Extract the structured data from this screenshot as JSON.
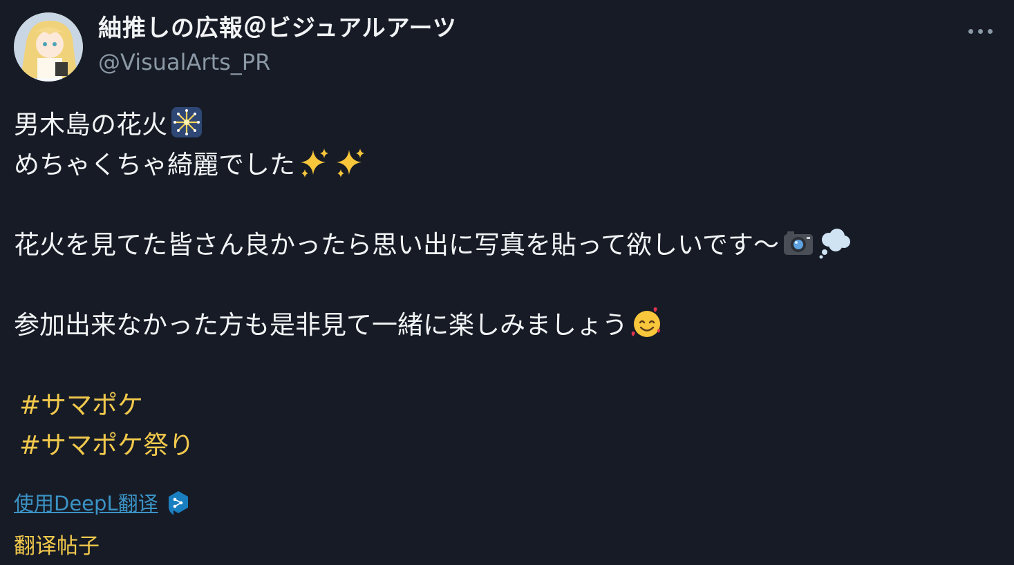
{
  "user": {
    "display_name": "紬推しの広報＠ビジュアルアーツ",
    "handle": "@VisualArts_PR",
    "avatar_icon": "avatar-character-icon"
  },
  "menu": {
    "more_icon": "more-options-icon"
  },
  "tweet": {
    "line1": "男木島の花火",
    "line2": "めちゃくちゃ綺麗でした",
    "line3": "花火を見てた皆さん良かったら思い出に写真を貼って欲しいです〜",
    "line4": "参加出来なかった方も是非見て一緒に楽しみましょう",
    "hashtags": [
      "#サマポケ",
      "#サマポケ祭り"
    ],
    "emojis": [
      "sparkler-icon",
      "sparkles-icon",
      "camera-icon",
      "thought-balloon-icon",
      "smiling-face-with-hearts-icon"
    ]
  },
  "deepl": {
    "label": "使用DeepL翻译",
    "icon": "deepl-logo-icon"
  },
  "translate": {
    "label": "翻译帖子"
  },
  "colors": {
    "background": "#161b26",
    "text": "#f1f3f4",
    "secondary": "#8b98a5",
    "hashtag": "#f2c94c",
    "link": "#3b93c5"
  }
}
